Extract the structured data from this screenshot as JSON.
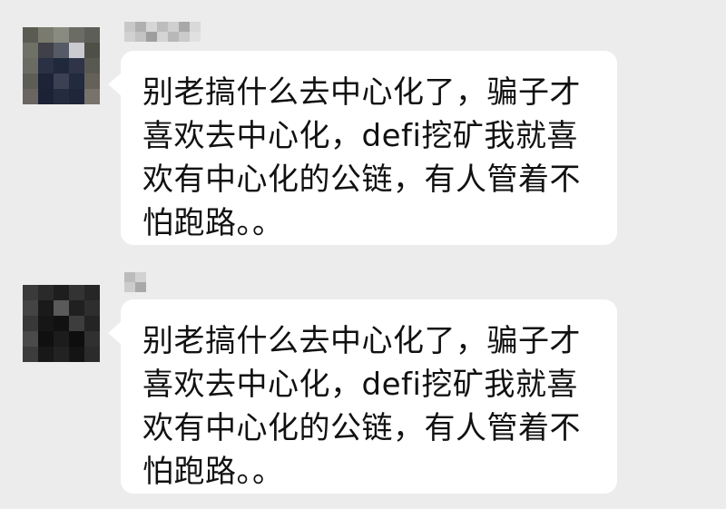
{
  "chat": {
    "background_color": "#ececec",
    "bubble_color": "#ffffff",
    "text_color": "#111111",
    "messages": [
      {
        "avatar_icon": "pixelated-avatar-icon",
        "sender_name_icon": "pixelated-name-icon",
        "text": "别老搞什么去中心化了，骗子才\n喜欢去中心化，defi挖矿我就喜\n欢有中心化的公链，有人管着不\n怕跑路。。"
      },
      {
        "avatar_icon": "pixelated-avatar-icon",
        "sender_name_icon": "pixelated-name-icon",
        "text": "别老搞什么去中心化了，骗子才\n喜欢去中心化，defi挖矿我就喜\n欢有中心化的公链，有人管着不\n怕跑路。。"
      }
    ]
  }
}
